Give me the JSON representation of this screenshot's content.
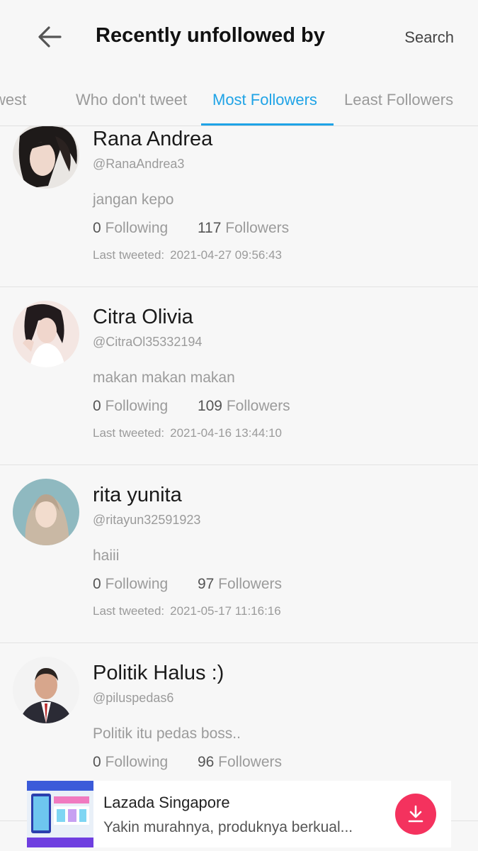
{
  "header": {
    "title": "Recently unfollowed by",
    "search_label": "Search"
  },
  "tabs": [
    {
      "label": "Who don't tweet"
    },
    {
      "label": "Most Followers"
    },
    {
      "label": "Least Followers"
    }
  ],
  "tabs_partial_left": "west",
  "active_tab": 1,
  "accent_color": "#1fa3e6",
  "users": [
    {
      "name": "Rana Andrea",
      "handle": "@RanaAndrea3",
      "bio": "jangan kepo",
      "following": "0",
      "following_label": "Following",
      "followers": "117",
      "followers_label": "Followers",
      "last_label": "Last tweeted:",
      "last_time": "2021-04-27 09:56:43"
    },
    {
      "name": "Citra Olivia",
      "handle": "@CitraOl35332194",
      "bio": "makan makan makan",
      "following": "0",
      "following_label": "Following",
      "followers": "109",
      "followers_label": "Followers",
      "last_label": "Last tweeted:",
      "last_time": "2021-04-16 13:44:10"
    },
    {
      "name": "rita yunita",
      "handle": "@ritayun32591923",
      "bio": "haiii",
      "following": "0",
      "following_label": "Following",
      "followers": "97",
      "followers_label": "Followers",
      "last_label": "Last tweeted:",
      "last_time": "2021-05-17 11:16:16"
    },
    {
      "name": "Politik Halus :)",
      "handle": "@piluspedas6",
      "bio": "Politik itu pedas boss..",
      "following": "0",
      "following_label": "Following",
      "followers": "96",
      "followers_label": "Followers"
    }
  ],
  "ad": {
    "title": "Lazada Singapore",
    "description": "Yakin murahnya, produknya berkual...",
    "button_color": "#f4325e",
    "button_icon": "download-icon"
  }
}
